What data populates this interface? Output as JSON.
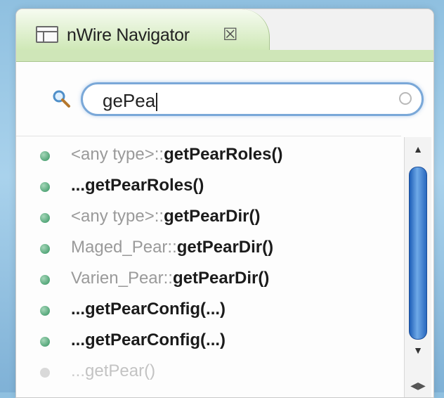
{
  "tab": {
    "title": "nWire Navigator",
    "close_glyph": "☒",
    "icon": "window-icon"
  },
  "search": {
    "value": "gePea",
    "icon": "magnifier-icon",
    "clear_icon": "clear-icon"
  },
  "results": [
    {
      "prefix": "<any type>::",
      "name": "getPearRoles()"
    },
    {
      "prefix": "...",
      "name": "getPearRoles()"
    },
    {
      "prefix": "<any type>::",
      "name": "getPearDir()"
    },
    {
      "prefix": "Maged_Pear::",
      "name": "getPearDir()"
    },
    {
      "prefix": "Varien_Pear::",
      "name": "getPearDir()"
    },
    {
      "prefix": "...",
      "name": "getPearConfig(...)"
    },
    {
      "prefix": "...",
      "name": "getPearConfig(...)"
    },
    {
      "prefix": "...",
      "name": "getPear()"
    }
  ],
  "scrollbar": {
    "up_glyph": "▲",
    "down_glyph": "▼",
    "corner_glyph": "◀▶"
  },
  "colors": {
    "accent_blue": "#7aa8d8",
    "tab_green": "#cfe6b8",
    "dot_green": "#55a77a"
  }
}
